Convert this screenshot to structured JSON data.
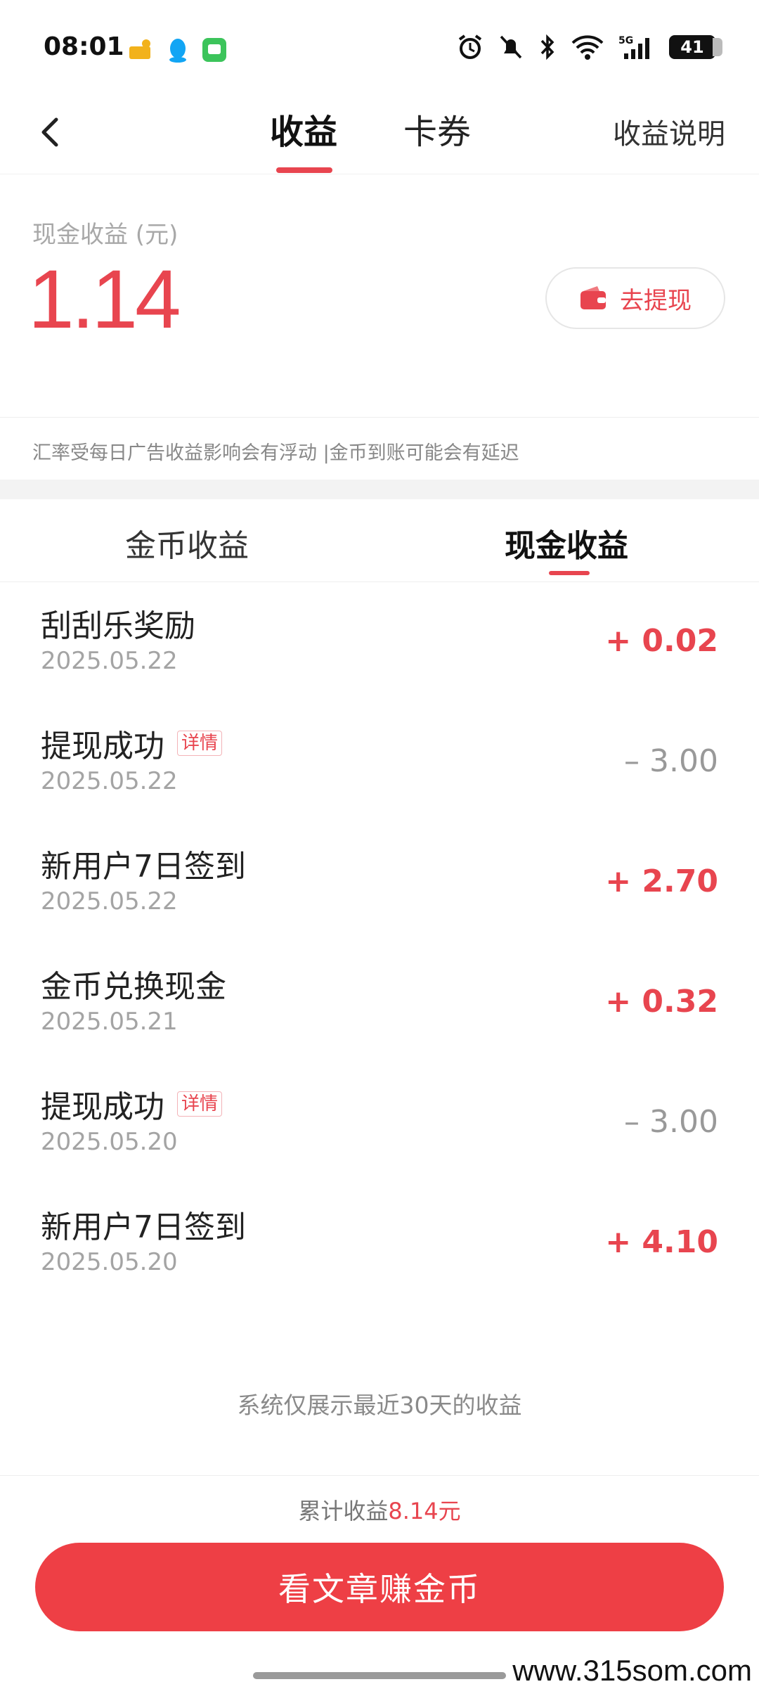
{
  "status_bar": {
    "time": "08:01",
    "battery": "41",
    "network": "5G"
  },
  "nav": {
    "tabs": [
      {
        "label": "收益",
        "active": true
      },
      {
        "label": "卡券",
        "active": false
      }
    ],
    "right_link": "收益说明"
  },
  "balance": {
    "label": "现金收益 (元)",
    "amount": "1.14",
    "withdraw_label": "去提现"
  },
  "notice": "汇率受每日广告收益影响会有浮动 |金币到账可能会有延迟",
  "subtabs": [
    {
      "label": "金币收益",
      "active": false
    },
    {
      "label": "现金收益",
      "active": true
    }
  ],
  "records": [
    {
      "title": "刮刮乐奖励",
      "tag": "",
      "date": "2025.05.22",
      "amount": "+ 0.02",
      "type": "plus"
    },
    {
      "title": "提现成功",
      "tag": "详情",
      "date": "2025.05.22",
      "amount": "– 3.00",
      "type": "minus"
    },
    {
      "title": "新用户7日签到",
      "tag": "",
      "date": "2025.05.22",
      "amount": "+ 2.70",
      "type": "plus"
    },
    {
      "title": "金币兑换现金",
      "tag": "",
      "date": "2025.05.21",
      "amount": "+ 0.32",
      "type": "plus"
    },
    {
      "title": "提现成功",
      "tag": "详情",
      "date": "2025.05.20",
      "amount": "– 3.00",
      "type": "minus"
    },
    {
      "title": "新用户7日签到",
      "tag": "",
      "date": "2025.05.20",
      "amount": "+ 4.10",
      "type": "plus"
    }
  ],
  "footer_note": "系统仅展示最近30天的收益",
  "total": {
    "label": "累计收益",
    "value": "8.14元"
  },
  "cta_label": "看文章赚金币",
  "watermark": "www.315som.com",
  "colors": {
    "accent": "#e8454f",
    "cta": "#ee3f45"
  }
}
